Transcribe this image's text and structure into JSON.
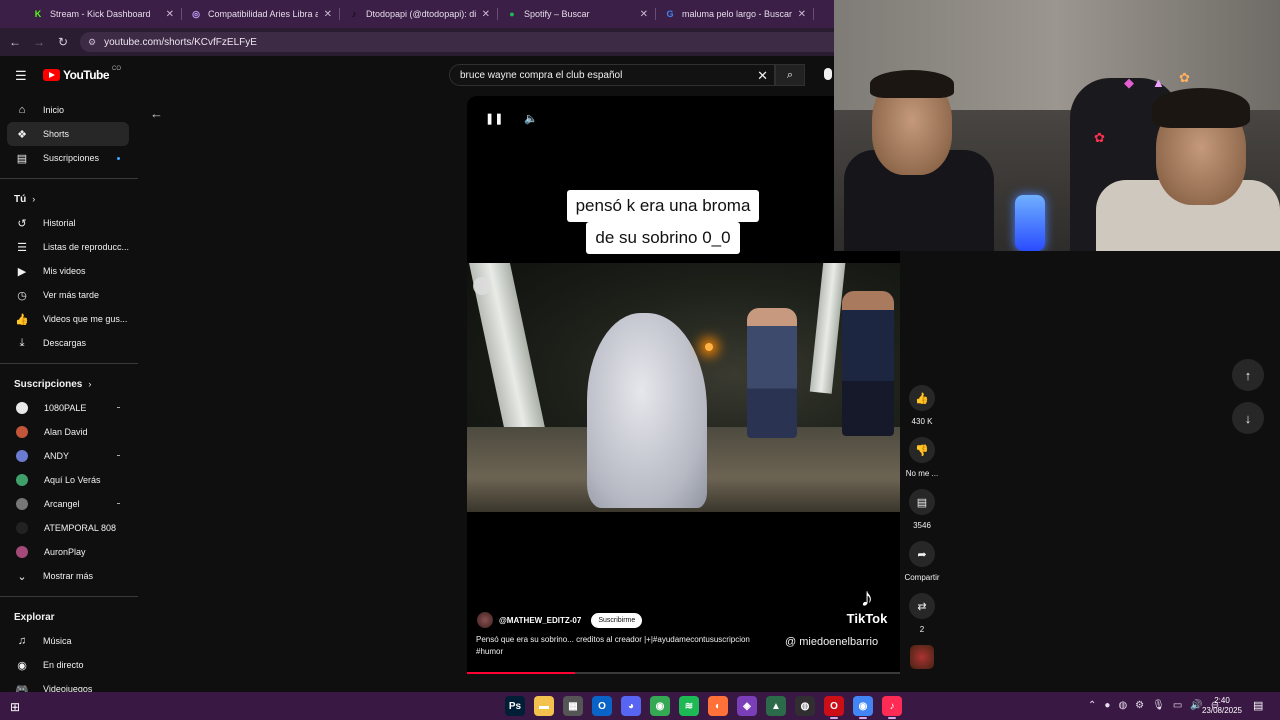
{
  "browser": {
    "tabs": [
      {
        "label": "Stream - Kick Dashboard",
        "icon": "K",
        "color": "#53fc18"
      },
      {
        "label": "Compatibilidad Aries Libra amo",
        "icon": "◎",
        "color": "#c9a3ff"
      },
      {
        "label": "Dtodopapi (@dtodopapi): disfr",
        "icon": "♪",
        "color": "#000000"
      },
      {
        "label": "Spotify – Buscar",
        "icon": "●",
        "color": "#1db954"
      },
      {
        "label": "maluma pelo largo - Buscar co",
        "icon": "G",
        "color": "#4285f4"
      }
    ],
    "url": "youtube.com/shorts/KCvfFzELFyE"
  },
  "youtube": {
    "logo_text": "YouTube",
    "country_code": "CO",
    "search_query": "bruce wayne compra el club español",
    "sidebar": {
      "main": [
        {
          "label": "Inicio",
          "icon": "home-icon",
          "glyph": "⌂"
        },
        {
          "label": "Shorts",
          "icon": "shorts-icon",
          "glyph": "❖"
        },
        {
          "label": "Suscripciones",
          "icon": "subscriptions-icon",
          "glyph": "▤"
        }
      ],
      "you_heading": "Tú",
      "you": [
        {
          "label": "Historial",
          "icon": "history-icon",
          "glyph": "↺"
        },
        {
          "label": "Listas de reproducc...",
          "icon": "playlists-icon",
          "glyph": "☰"
        },
        {
          "label": "Mis videos",
          "icon": "my-videos-icon",
          "glyph": "▶"
        },
        {
          "label": "Ver más tarde",
          "icon": "watch-later-icon",
          "glyph": "◷"
        },
        {
          "label": "Videos que me gus...",
          "icon": "liked-videos-icon",
          "glyph": "👍"
        },
        {
          "label": "Descargas",
          "icon": "downloads-icon",
          "glyph": "⤓"
        }
      ],
      "subs_heading": "Suscripciones",
      "subscriptions": [
        {
          "label": "1080PALE",
          "color": "#e8e8e8"
        },
        {
          "label": "Alan David",
          "color": "#c2563a"
        },
        {
          "label": "ANDY",
          "color": "#6a7bd1"
        },
        {
          "label": "Aquí Lo Verás",
          "color": "#3fa06a"
        },
        {
          "label": "Arcangel",
          "color": "#777777"
        },
        {
          "label": "ATEMPORAL 808",
          "color": "#222222"
        },
        {
          "label": "AuronPlay",
          "color": "#a34a7a"
        }
      ],
      "show_more": "Mostrar más",
      "explore_heading": "Explorar",
      "explore": [
        {
          "label": "Música",
          "icon": "music-icon",
          "glyph": "♫"
        },
        {
          "label": "En directo",
          "icon": "live-icon",
          "glyph": "◉"
        },
        {
          "label": "Videojuegos",
          "icon": "gaming-icon",
          "glyph": "🎮"
        }
      ]
    },
    "short": {
      "caption_line1": "pensó k era una broma",
      "caption_line2": "de su sobrino 0_0",
      "watermark_brand": "TikTok",
      "watermark_user": "@ miedoenelbarrio",
      "channel": "@MATHEW_EDITZ-07",
      "subscribe_label": "Suscribirme",
      "description": "Pensó que era su sobrino... creditos al creador |+|#ayudamecontususcripcion #humor",
      "progress": 0.25
    },
    "actions": [
      {
        "label": "430 K",
        "icon": "like-icon",
        "glyph": "👍"
      },
      {
        "label": "No me ...",
        "icon": "dislike-icon",
        "glyph": "👎"
      },
      {
        "label": "3546",
        "icon": "comments-icon",
        "glyph": "▤"
      },
      {
        "label": "Compartir",
        "icon": "share-icon",
        "glyph": "➦"
      },
      {
        "label": "2",
        "icon": "remix-icon",
        "glyph": "⇄"
      }
    ]
  },
  "taskbar": {
    "time": "2:40",
    "date": "23/08/2025",
    "apps": [
      {
        "name": "photoshop",
        "glyph": "Ps",
        "color": "#001e36"
      },
      {
        "name": "file-explorer",
        "glyph": "▬",
        "color": "#f2c14e"
      },
      {
        "name": "calculator",
        "glyph": "▦",
        "color": "#555555"
      },
      {
        "name": "outlook",
        "glyph": "O",
        "color": "#0a64c8"
      },
      {
        "name": "discord",
        "glyph": "◕",
        "color": "#5865f2"
      },
      {
        "name": "chrome",
        "glyph": "◉",
        "color": "#34a853"
      },
      {
        "name": "spotify",
        "glyph": "≋",
        "color": "#1db954"
      },
      {
        "name": "firefox",
        "glyph": "◐",
        "color": "#ff7139"
      },
      {
        "name": "app-purple",
        "glyph": "◈",
        "color": "#7a3fb8"
      },
      {
        "name": "app-green",
        "glyph": "▲",
        "color": "#2b6b4a"
      },
      {
        "name": "obs",
        "glyph": "◍",
        "color": "#302e31"
      },
      {
        "name": "opera",
        "glyph": "O",
        "color": "#cc0f16"
      },
      {
        "name": "chrome-active",
        "glyph": "◉",
        "color": "#4285f4"
      },
      {
        "name": "tiktok",
        "glyph": "♪",
        "color": "#fe2c55"
      }
    ]
  }
}
